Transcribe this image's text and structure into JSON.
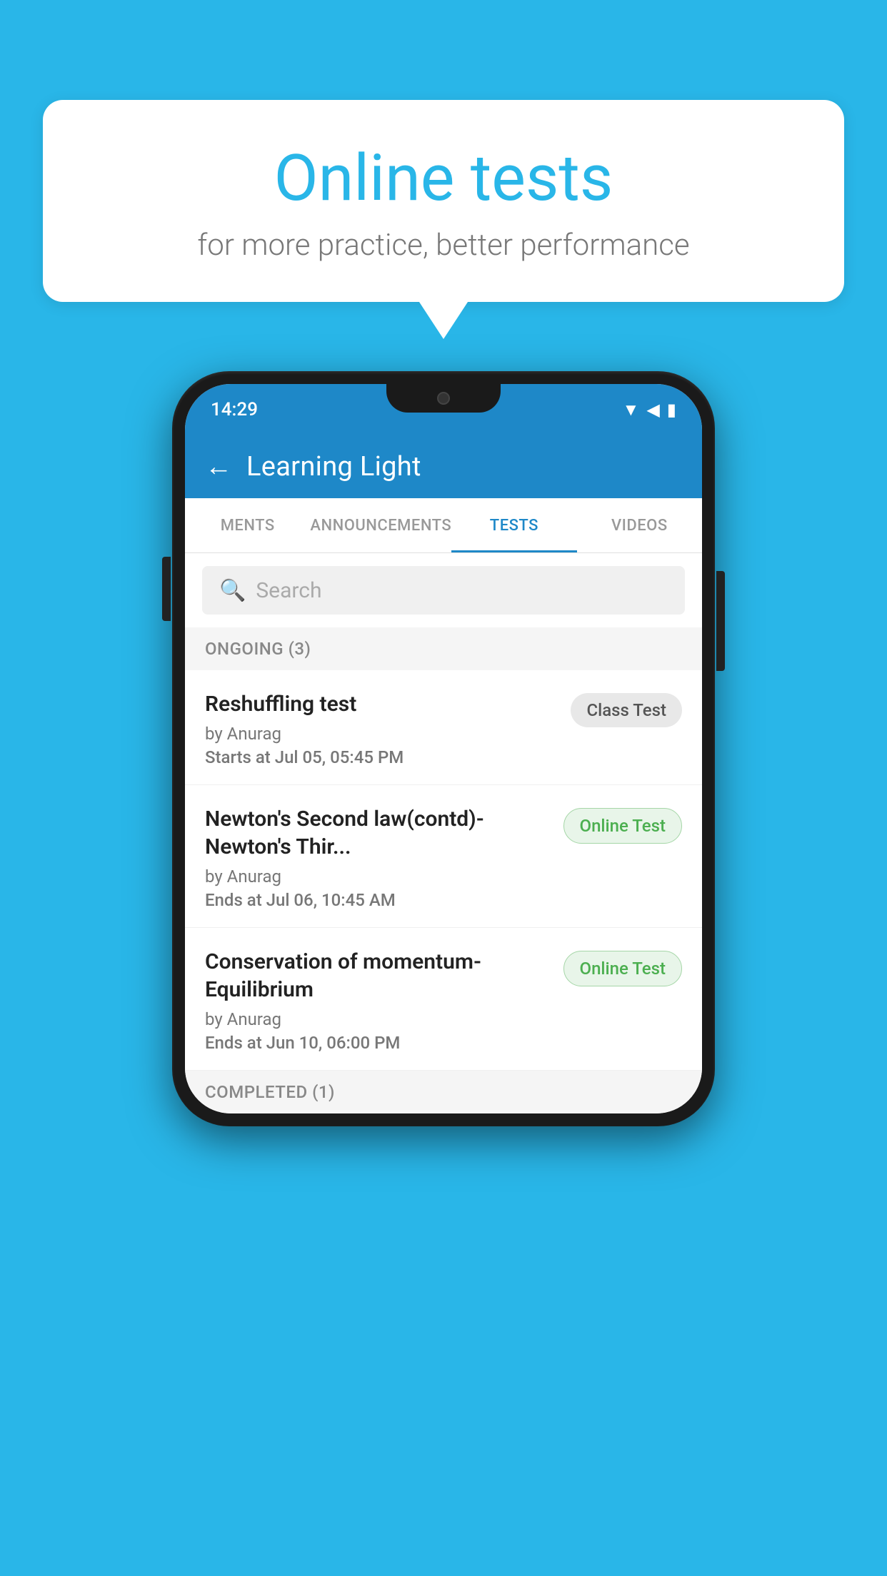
{
  "background_color": "#29b6e8",
  "bubble": {
    "title": "Online tests",
    "subtitle": "for more practice, better performance"
  },
  "phone": {
    "status_bar": {
      "time": "14:29",
      "icons": [
        "wifi",
        "signal",
        "battery"
      ]
    },
    "header": {
      "title": "Learning Light",
      "back_label": "←"
    },
    "tabs": [
      {
        "label": "MENTS",
        "active": false
      },
      {
        "label": "ANNOUNCEMENTS",
        "active": false
      },
      {
        "label": "TESTS",
        "active": true
      },
      {
        "label": "VIDEOS",
        "active": false
      }
    ],
    "search": {
      "placeholder": "Search"
    },
    "ongoing_section": {
      "title": "ONGOING (3)"
    },
    "tests": [
      {
        "name": "Reshuffling test",
        "by": "by Anurag",
        "time_label": "Starts at",
        "time_value": "Jul 05, 05:45 PM",
        "badge": "Class Test",
        "badge_type": "class"
      },
      {
        "name": "Newton's Second law(contd)-Newton's Thir...",
        "by": "by Anurag",
        "time_label": "Ends at",
        "time_value": "Jul 06, 10:45 AM",
        "badge": "Online Test",
        "badge_type": "online"
      },
      {
        "name": "Conservation of momentum-Equilibrium",
        "by": "by Anurag",
        "time_label": "Ends at",
        "time_value": "Jun 10, 06:00 PM",
        "badge": "Online Test",
        "badge_type": "online"
      }
    ],
    "completed_section": {
      "title": "COMPLETED (1)"
    }
  }
}
